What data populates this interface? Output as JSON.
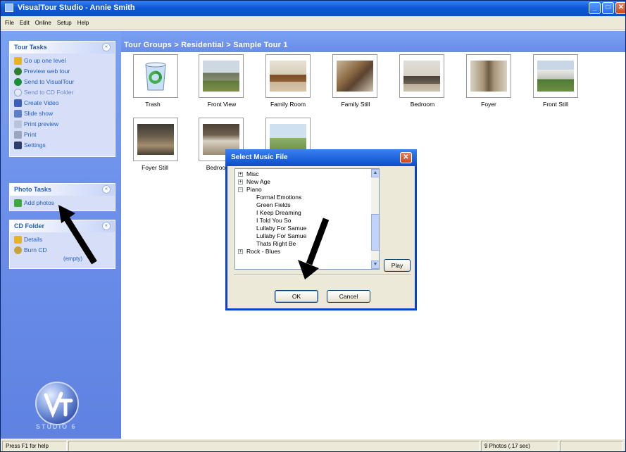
{
  "window": {
    "title": "VisualTour Studio - Annie Smith"
  },
  "menu": [
    "File",
    "Edit",
    "Online",
    "Setup",
    "Help"
  ],
  "sidebar": {
    "tour_tasks": {
      "title": "Tour Tasks",
      "items": [
        {
          "label": "Go up one level",
          "icon": "folder-up-icon"
        },
        {
          "label": "Preview web tour",
          "icon": "magnifier-icon"
        },
        {
          "label": "Send to VisualTour",
          "icon": "globe-icon"
        },
        {
          "label": "Send to CD Folder",
          "icon": "cd-icon"
        },
        {
          "label": "Create Video",
          "icon": "video-icon"
        },
        {
          "label": "Slide show",
          "icon": "slideshow-icon"
        },
        {
          "label": "Print preview",
          "icon": "print-preview-icon"
        },
        {
          "label": "Print",
          "icon": "printer-icon"
        },
        {
          "label": "Settings",
          "icon": "settings-icon"
        }
      ]
    },
    "photo_tasks": {
      "title": "Photo Tasks",
      "items": [
        {
          "label": "Add photos",
          "icon": "add-icon"
        }
      ]
    },
    "cd_folder": {
      "title": "CD Folder",
      "items": [
        {
          "label": "Details",
          "icon": "folder-icon"
        },
        {
          "label": "Burn CD",
          "icon": "burn-cd-icon"
        }
      ],
      "status": "(empty)"
    },
    "logo_text": "STUDIO 6"
  },
  "breadcrumb": "Tour Groups > Residential > Sample Tour 1",
  "thumbnails": [
    {
      "label": "Trash"
    },
    {
      "label": "Front View"
    },
    {
      "label": "Family Room"
    },
    {
      "label": "Family Still"
    },
    {
      "label": "Bedroom"
    },
    {
      "label": "Foyer"
    },
    {
      "label": "Front Still"
    },
    {
      "label": "Foyer Still"
    },
    {
      "label": "Bedroom"
    },
    {
      "label": ""
    }
  ],
  "dialog": {
    "title": "Select Music File",
    "tree": [
      {
        "label": "Misc",
        "expander": "+"
      },
      {
        "label": "New Age",
        "expander": "+"
      },
      {
        "label": "Piano",
        "expander": "−"
      },
      {
        "label": "Formal Emotions"
      },
      {
        "label": "Green Fields"
      },
      {
        "label": "I Keep Dreaming"
      },
      {
        "label": "I Told You So"
      },
      {
        "label": "Lullaby For Samue"
      },
      {
        "label": "Lullaby For Samue"
      },
      {
        "label": "Thats Right Be"
      },
      {
        "label": "Rock - Blues",
        "expander": "+"
      }
    ],
    "play_label": "Play",
    "ok_label": "OK",
    "cancel_label": "Cancel"
  },
  "statusbar": {
    "help": "Press F1 for help",
    "photos": "9 Photos (.17 sec)"
  },
  "colors": {
    "xp_blue": "#0a4fc8",
    "sidebar_blue": "#6a8de9",
    "link_blue": "#215dc6"
  }
}
